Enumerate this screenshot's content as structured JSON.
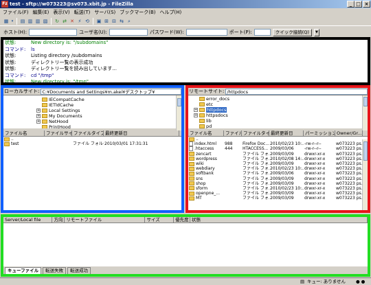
{
  "window": {
    "title": "test - sftp://w073223@sv073.xbit.jp - FileZilla",
    "app_icon": "Fz"
  },
  "menu": [
    "ファイル(F)",
    "編集(E)",
    "表示(V)",
    "転送(T)",
    "サーバ(S)",
    "ブックマーク(B)",
    "ヘルプ(H)"
  ],
  "quick": {
    "host_label": "ホスト(H):",
    "user_label": "ユーザ名(U):",
    "pass_label": "パスワード(W):",
    "port_label": "ポート(P):",
    "connect_label": "クイック接続(Q)"
  },
  "log": [
    {
      "label": "状態:",
      "text": "New directory is: \"/subdomains\"",
      "color": "green"
    },
    {
      "label": "コマンド:",
      "text": "ls",
      "color": "blue"
    },
    {
      "label": "状態:",
      "text": "Listing directory /subdomains",
      "color": "black"
    },
    {
      "label": "状態:",
      "text": "ディレクトリ一覧の表示成功",
      "color": "black"
    },
    {
      "label": "状態:",
      "text": "ディレクトリ一覧を読み出しています...",
      "color": "black"
    },
    {
      "label": "コマンド:",
      "text": "cd \"/tmp\"",
      "color": "blue"
    },
    {
      "label": "状態:",
      "text": "New directory is: \"/tmp\"",
      "color": "green"
    }
  ],
  "local": {
    "site_label": "ローカルサイト:",
    "path": "C:¥Documents and Settings¥m.akei¥デスクトップ¥",
    "tree": [
      {
        "name": "IECompatCache",
        "expander": "none"
      },
      {
        "name": "IETldCache",
        "expander": "none"
      },
      {
        "name": "Local Settings",
        "expander": "+"
      },
      {
        "name": "My Documents",
        "expander": "+"
      },
      {
        "name": "NetHood",
        "expander": "+"
      },
      {
        "name": "PrintHood",
        "expander": "none"
      }
    ],
    "columns": [
      "ファイル名",
      "ファイルサイズ",
      "ファイルタイプ",
      "最終更新日"
    ],
    "files": [
      {
        "name": "..",
        "size": "",
        "type": "",
        "date": "",
        "icon": "folder"
      },
      {
        "name": "test",
        "size": "",
        "type": "ファイル フォルダ",
        "date": "2010/03/01 17:31:31",
        "icon": "folder"
      }
    ]
  },
  "remote": {
    "site_label": "リモートサイト:",
    "path": "/httpdocs",
    "tree": [
      {
        "name": "error_docs",
        "expander": "none",
        "selected": false
      },
      {
        "name": "etc",
        "expander": "none",
        "selected": false
      },
      {
        "name": "httpdocs",
        "expander": "+",
        "selected": true
      },
      {
        "name": "httpsdocs",
        "expander": "+",
        "selected": false
      },
      {
        "name": "lib",
        "expander": "none",
        "selected": false
      },
      {
        "name": "pd",
        "expander": "none",
        "selected": false
      }
    ],
    "columns": [
      "ファイル名",
      "ファイルサイズ",
      "ファイルタイプ",
      "最終更新日",
      "パーミッション",
      "Owner/Gr..."
    ],
    "files": [
      {
        "name": "..",
        "size": "",
        "type": "",
        "date": "",
        "perm": "",
        "owner": "",
        "icon": "folder"
      },
      {
        "name": "index.html",
        "size": "988",
        "type": "Firefox Doc...",
        "date": "2010/02/23 10:...",
        "perm": "-rw-r--r--",
        "owner": "w073223 ps...",
        "icon": "file"
      },
      {
        "name": ".htaccess",
        "size": "444",
        "type": "HTACCESS...",
        "date": "2009/03/06",
        "perm": "-rw-r--r--",
        "owner": "w073223 ps...",
        "icon": "file"
      },
      {
        "name": "zencart",
        "size": "",
        "type": "ファイル フォ...",
        "date": "2009/03/09",
        "perm": "drwxr-xr-x",
        "owner": "w073223 ps...",
        "icon": "folder"
      },
      {
        "name": "wordpress",
        "size": "",
        "type": "ファイル フォ...",
        "date": "2010/02/08 14:...",
        "perm": "drwxr-xr-x",
        "owner": "w073223 ps...",
        "icon": "folder"
      },
      {
        "name": "wiki",
        "size": "",
        "type": "ファイル フォ...",
        "date": "2009/03/09",
        "perm": "drwxr-xr-x",
        "owner": "w073223 ps...",
        "icon": "folder"
      },
      {
        "name": "webdiary",
        "size": "",
        "type": "ファイル フォ...",
        "date": "2010/02/23 10:...",
        "perm": "drwxr-xr-x",
        "owner": "w073223 ps...",
        "icon": "folder"
      },
      {
        "name": "softbank",
        "size": "",
        "type": "ファイル フォ...",
        "date": "2009/03/06",
        "perm": "drwxr-xr-x",
        "owner": "w073223 ps...",
        "icon": "folder"
      },
      {
        "name": "sns",
        "size": "",
        "type": "ファイル フォ...",
        "date": "2009/03/09",
        "perm": "drwxr-xr-x",
        "owner": "w073223 ps...",
        "icon": "folder"
      },
      {
        "name": "shop",
        "size": "",
        "type": "ファイル フォ...",
        "date": "2009/03/09",
        "perm": "drwxr-xr-x",
        "owner": "w073223 ps...",
        "icon": "folder"
      },
      {
        "name": "sform",
        "size": "",
        "type": "ファイル フォ...",
        "date": "2010/02/23 10:...",
        "perm": "drwxr-xr-x",
        "owner": "w073223 ps...",
        "icon": "folder"
      },
      {
        "name": "openpne_...",
        "size": "",
        "type": "ファイル フォ...",
        "date": "2009/03/09",
        "perm": "drwxr-xr-x",
        "owner": "w073223 ps...",
        "icon": "folder"
      },
      {
        "name": "MT",
        "size": "",
        "type": "ファイル フォ...",
        "date": "2009/03/09",
        "perm": "drwxr-xr-x",
        "owner": "w073223 ps...",
        "icon": "folder"
      }
    ]
  },
  "queue": {
    "columns": [
      "Server/Local file",
      "方向",
      "リモートファイル",
      "サイズ",
      "優先度",
      "状態"
    ],
    "tabs": [
      "キューファイル",
      "転送失敗",
      "転送成功"
    ]
  },
  "status": {
    "queue_text": "キュー: ありません"
  }
}
